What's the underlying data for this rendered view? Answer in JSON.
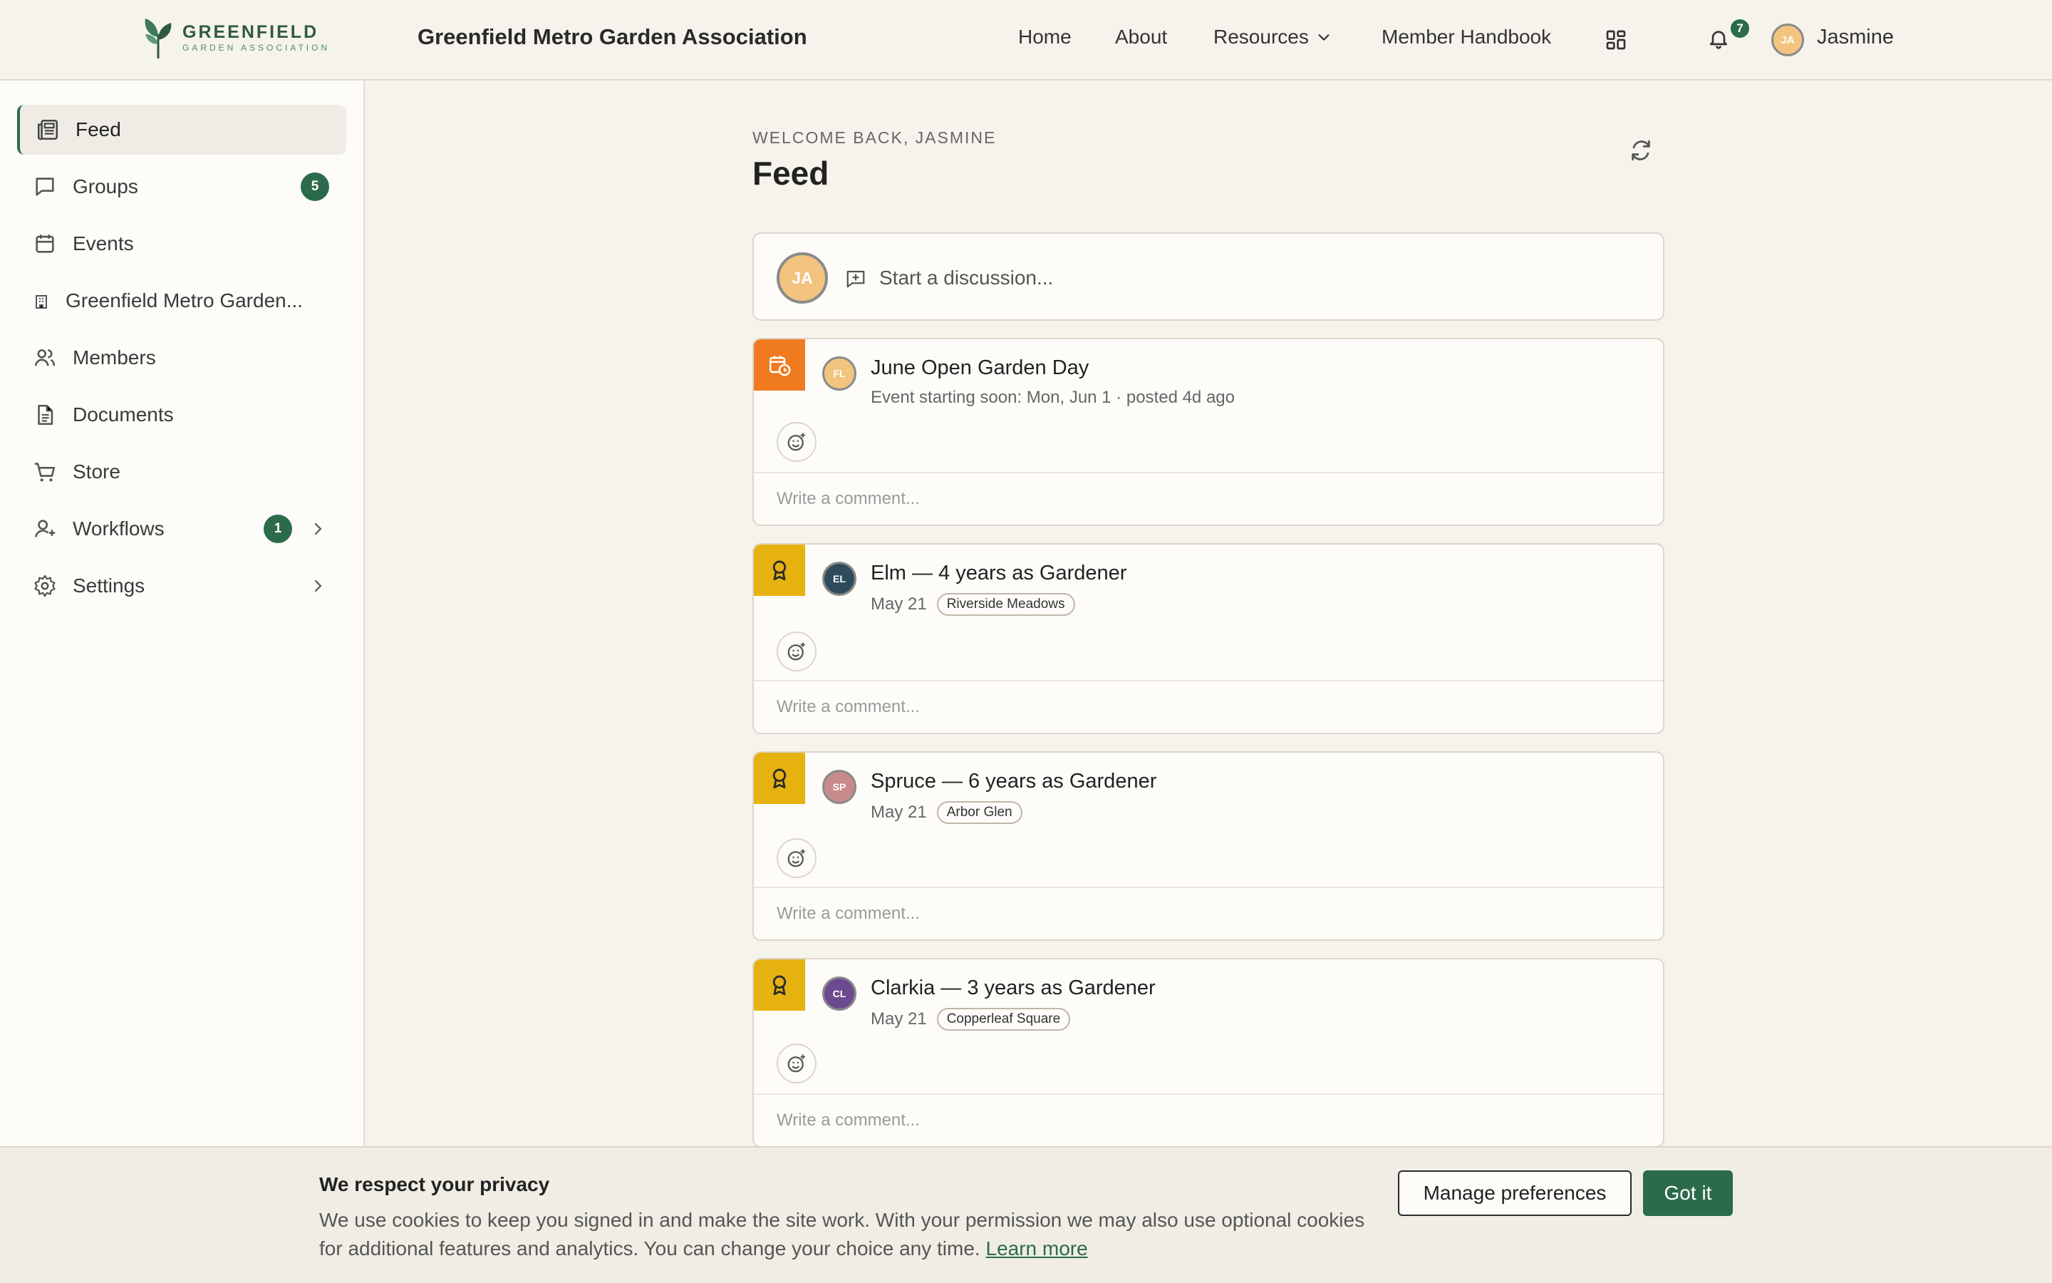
{
  "header": {
    "logo_main": "GREENFIELD",
    "logo_sub": "GARDEN ASSOCIATION",
    "site_title": "Greenfield Metro Garden Association",
    "nav": [
      "Home",
      "About",
      "Resources",
      "Member Handbook"
    ],
    "notification_count": "7",
    "user_initials": "JA",
    "user_name": "Jasmine"
  },
  "sidebar": {
    "items": [
      {
        "label": "Feed",
        "icon": "newspaper-icon"
      },
      {
        "label": "Groups",
        "icon": "chat-bubble-icon",
        "badge": "5"
      },
      {
        "label": "Events",
        "icon": "calendar-icon"
      },
      {
        "label": "Greenfield Metro Garden...",
        "icon": "building-icon"
      },
      {
        "label": "Members",
        "icon": "people-icon"
      },
      {
        "label": "Documents",
        "icon": "document-icon"
      },
      {
        "label": "Store",
        "icon": "cart-icon"
      },
      {
        "label": "Workflows",
        "icon": "user-plus-icon",
        "badge": "1"
      },
      {
        "label": "Settings",
        "icon": "gear-icon"
      }
    ]
  },
  "main": {
    "welcome": "WELCOME BACK, JASMINE",
    "title": "Feed",
    "composer": {
      "initials": "JA",
      "placeholder": "Start a discussion..."
    },
    "comment_placeholder": "Write a comment...",
    "posts": [
      {
        "title": "June Open Garden Day",
        "meta": "Event starting soon: Mon, Jun 1 · posted 4d ago",
        "initials": "FL",
        "avatar_color": "#f2c47f",
        "tag_color": "#f07a1f",
        "tag_icon": "calendar-clock-icon"
      },
      {
        "title": "Elm — 4 years as Gardener",
        "meta": "May 21",
        "pill": "Riverside Meadows",
        "initials": "EL",
        "avatar_color": "#2f4b5c",
        "tag_color": "#e5b20f",
        "tag_icon": "award-icon"
      },
      {
        "title": "Spruce — 6 years as Gardener",
        "meta": "May 21",
        "pill": "Arbor Glen",
        "initials": "SP",
        "avatar_color": "#c98a8c",
        "tag_color": "#e5b20f",
        "tag_icon": "award-icon"
      },
      {
        "title": "Clarkia — 3 years as Gardener",
        "meta": "May 21",
        "pill": "Copperleaf Square",
        "initials": "CL",
        "avatar_color": "#6c4a8f",
        "tag_color": "#e5b20f",
        "tag_icon": "award-icon"
      }
    ]
  },
  "cookie": {
    "title": "We respect your privacy",
    "body": "We use cookies to keep you signed in and make the site work. With your permission we may also use optional cookies for additional features and analytics. You can change your choice any time.",
    "link": "Learn more",
    "manage": "Manage preferences",
    "accept": "Got it"
  }
}
